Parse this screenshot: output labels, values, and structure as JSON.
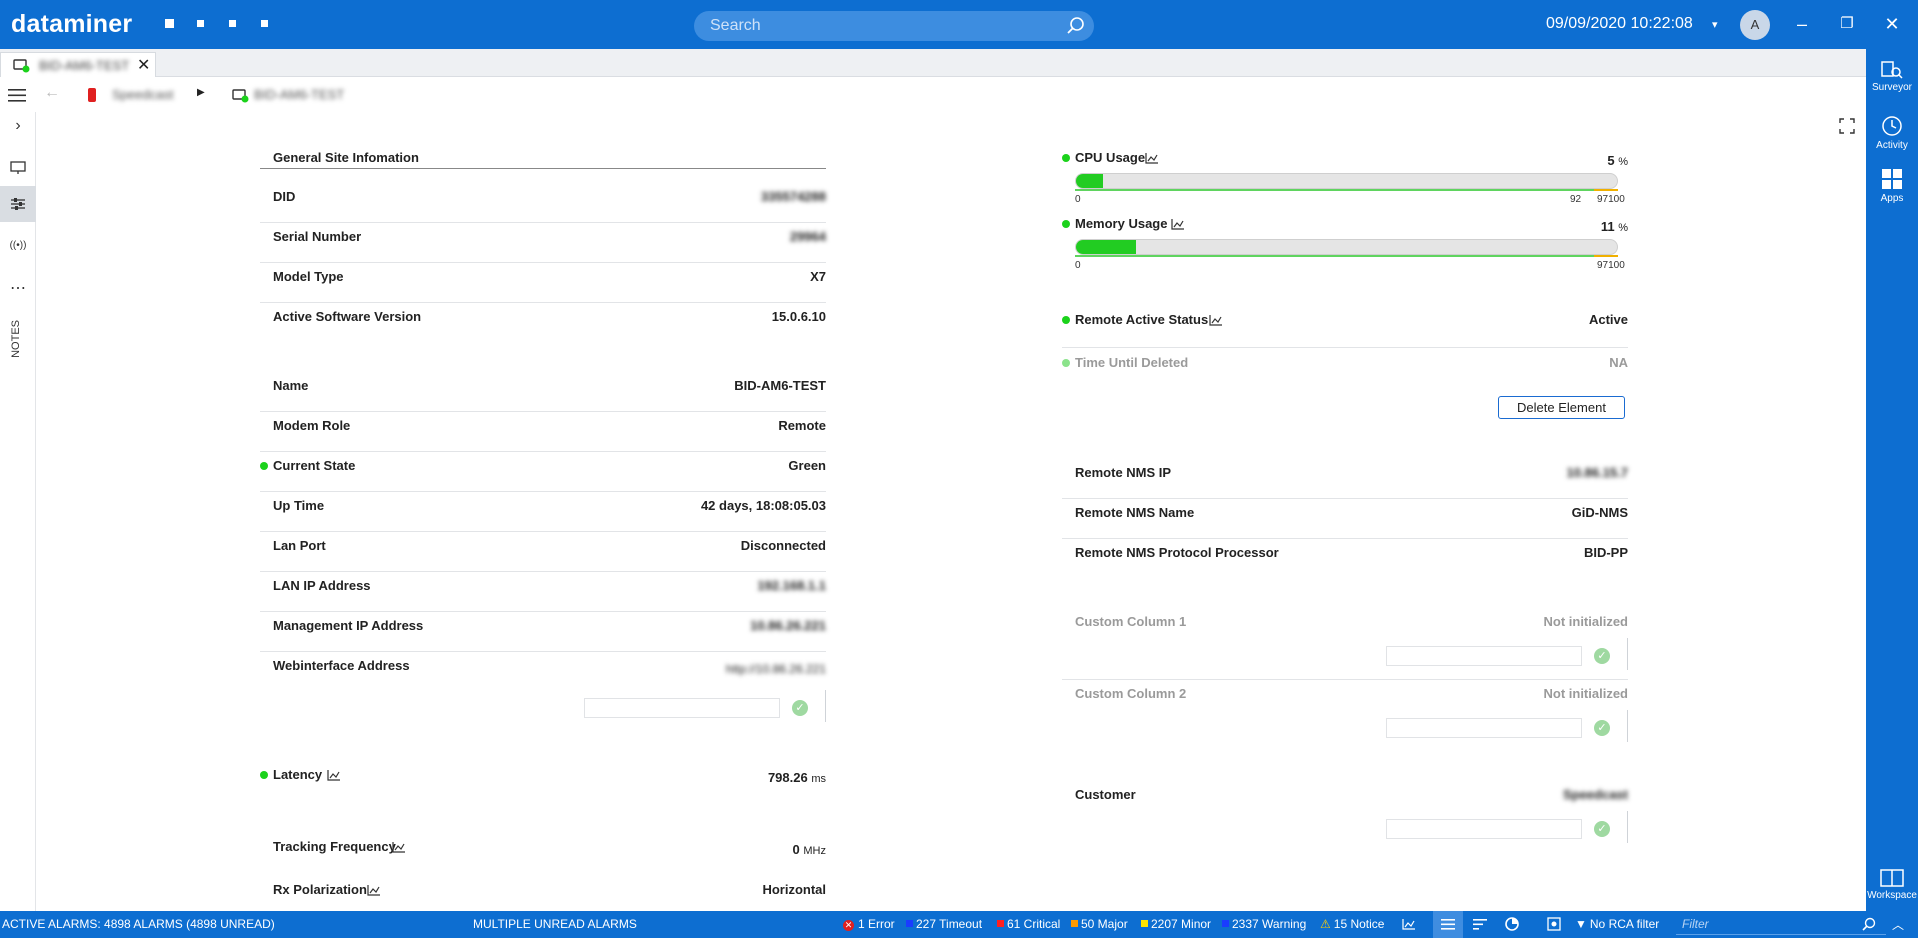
{
  "app": {
    "logo": "dataminer",
    "datetime": "09/09/2020 10:22:08",
    "avatar_initial": "A"
  },
  "search": {
    "placeholder": "Search"
  },
  "tab": {
    "name": "BID-AM6-TEST"
  },
  "breadcrumb": {
    "item1": "Speedcast",
    "item2": "BID-AM6-TEST"
  },
  "left_rail": {
    "notes": "NOTES"
  },
  "right_rail": {
    "surveyor": "Surveyor",
    "activity": "Activity",
    "apps": "Apps",
    "workspace": "Workspace"
  },
  "left_panel": {
    "section_title": "General Site Infomation",
    "group1": [
      {
        "label": "DID",
        "value": "335574288"
      },
      {
        "label": "Serial Number",
        "value": "29964"
      },
      {
        "label": "Model Type",
        "value": "X7"
      },
      {
        "label": "Active Software Version",
        "value": "15.0.6.10"
      }
    ],
    "group2": [
      {
        "label": "Name",
        "value": "BID-AM6-TEST"
      },
      {
        "label": "Modem Role",
        "value": "Remote"
      },
      {
        "label": "Current State",
        "value": "Green"
      },
      {
        "label": "Up Time",
        "value": "42 days, 18:08:05.03"
      },
      {
        "label": "Lan Port",
        "value": "Disconnected"
      },
      {
        "label": "LAN IP Address",
        "value": "192.168.1.1"
      },
      {
        "label": "Management IP Address",
        "value": "10.86.26.221"
      },
      {
        "label": "Webinterface Address",
        "value": "http://10.86.26.221"
      }
    ],
    "latency": {
      "label": "Latency",
      "value": "798.26",
      "unit": "ms"
    },
    "tracking": {
      "label": "Tracking Frequency",
      "value": "0",
      "unit": "MHz"
    },
    "rxpol": {
      "label": "Rx Polarization",
      "value": "Horizontal"
    }
  },
  "right_panel": {
    "cpu": {
      "label": "CPU Usage",
      "value": "5",
      "unit": "%",
      "fraction": 0.05,
      "tick_min": "0",
      "tick_warn": "92",
      "tick_max": "97100"
    },
    "memory": {
      "label": "Memory Usage",
      "value": "11",
      "unit": "%",
      "fraction": 0.11,
      "tick_min": "0",
      "tick_max": "97100"
    },
    "remote_active": {
      "label": "Remote Active Status",
      "value": "Active"
    },
    "time_until_deleted": {
      "label": "Time Until Deleted",
      "value": "NA"
    },
    "delete_button": "Delete Element",
    "nms": [
      {
        "label": "Remote NMS IP",
        "value": "10.86.15.7"
      },
      {
        "label": "Remote NMS Name",
        "value": "GiD-NMS"
      },
      {
        "label": "Remote NMS Protocol Processor",
        "value": "BID-PP"
      }
    ],
    "custom1": {
      "label": "Custom Column 1",
      "value": "Not initialized"
    },
    "custom2": {
      "label": "Custom Column 2",
      "value": "Not initialized"
    },
    "customer": {
      "label": "Customer",
      "value": "Speedcast"
    }
  },
  "statusbar": {
    "active_alarms": "ACTIVE ALARMS: 4898 ALARMS (4898 UNREAD)",
    "unread": "MULTIPLE UNREAD ALARMS",
    "error": "1 Error",
    "timeout": "227 Timeout",
    "critical": "61 Critical",
    "major": "50 Major",
    "minor": "2207 Minor",
    "warning": "2337 Warning",
    "notice": "15 Notice",
    "rca": "No RCA filter",
    "filter_placeholder": "Filter",
    "colors": {
      "error": "#e02020",
      "timeout": "#1a3cff",
      "critical": "#ff2020",
      "major": "#ff9a00",
      "minor": "#ffe400",
      "warning": "#1a3cff",
      "notice": "#ffd000"
    }
  }
}
